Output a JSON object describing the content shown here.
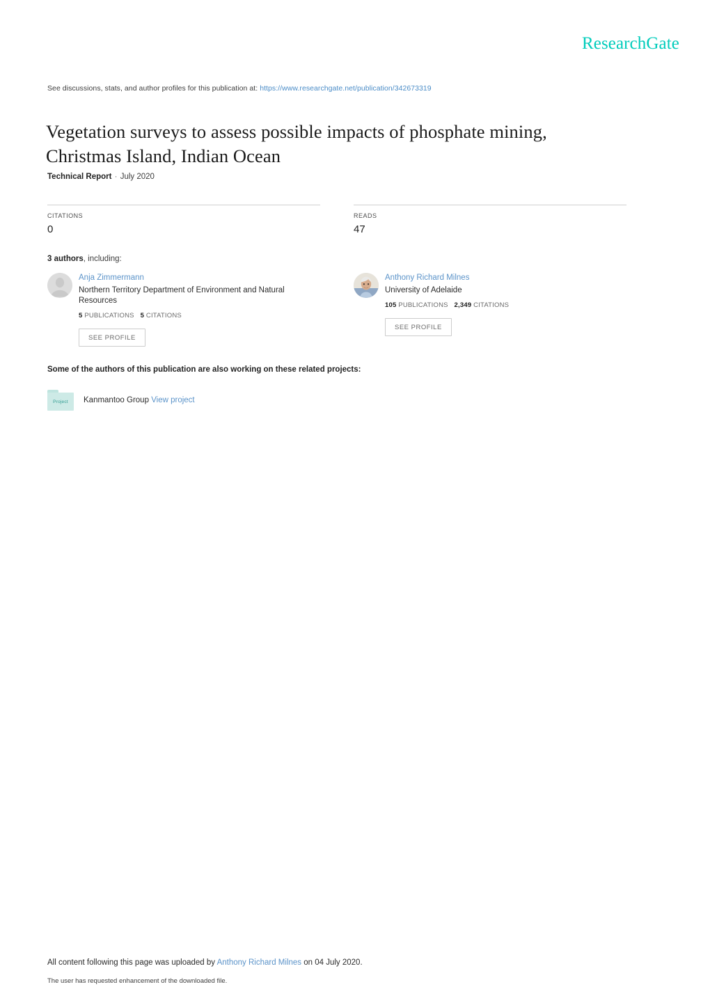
{
  "brand": {
    "logo_text": "ResearchGate",
    "logo_color": "#00ccbb"
  },
  "discussion": {
    "prefix": "See discussions, stats, and author profiles for this publication at:",
    "url": "https://www.researchgate.net/publication/342673319"
  },
  "publication": {
    "title": "Vegetation surveys to assess possible impacts of phosphate mining, Christmas Island, Indian Ocean",
    "type": "Technical Report",
    "separator": "·",
    "date": "July 2020"
  },
  "stats": [
    {
      "label": "CITATIONS",
      "value": "0"
    },
    {
      "label": "READS",
      "value": "47"
    }
  ],
  "authors_section": {
    "count_text": "3 authors",
    "suffix": ", including:",
    "see_profile_label": "SEE PROFILE"
  },
  "authors": [
    {
      "name": "Anja Zimmermann",
      "affiliation": "Northern Territory Department of Environment and Natural Resources",
      "publications_count": "5",
      "publications_label": "PUBLICATIONS",
      "citations_count": "5",
      "citations_label": "CITATIONS",
      "avatar_type": "placeholder"
    },
    {
      "name": "Anthony Richard Milnes",
      "affiliation": "University of Adelaide",
      "publications_count": "105",
      "publications_label": "PUBLICATIONS",
      "citations_count": "2,349",
      "citations_label": "CITATIONS",
      "avatar_type": "photo"
    }
  ],
  "projects": {
    "heading": "Some of the authors of this publication are also working on these related projects:",
    "items": [
      {
        "icon_text": "Project",
        "name": "Kanmantoo Group",
        "link_label": "View project"
      }
    ]
  },
  "footer": {
    "upload_prefix": "All content following this page was uploaded by",
    "uploader": "Anthony Richard Milnes",
    "upload_suffix": "on 04 July 2020.",
    "note": "The user has requested enhancement of the downloaded file."
  }
}
